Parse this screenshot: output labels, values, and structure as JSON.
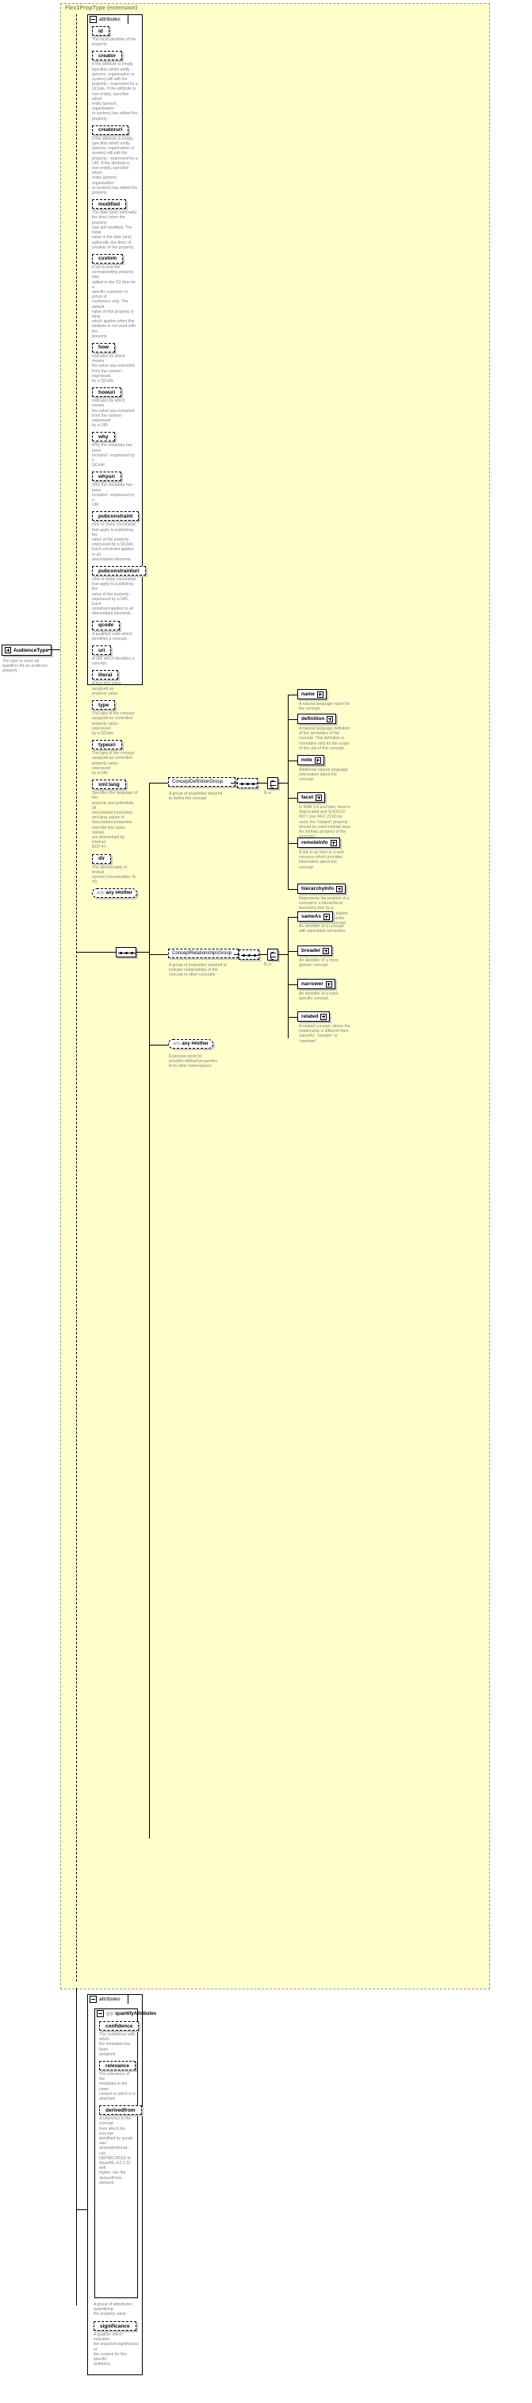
{
  "diagram": {
    "title": "Flex1PropType (extension)",
    "root_type": {
      "label": "AudienceType",
      "description": "The type to cover all\nqualifiers for an audience\nproperty."
    },
    "attributes_label": "attributes",
    "any_other": "any ##other",
    "any_other_2": "any ##other",
    "any_other_2_desc": "Extension point for\nprovider-defined properties\nfrom other namespaces.",
    "group_keyword": "grp"
  },
  "flex_attributes": [
    {
      "name": "id",
      "desc": "The local identifier of the\nproperty."
    },
    {
      "name": "creator",
      "desc": "If the attribute is empty,\nspecifies which entity\n(person, organisation or\nsystem) will edit the\nproperty - expressed by a\nQCode. If the attribute is\nnon-empty, specifies which\nentity (person, organisation\nor system) has edited the\nproperty."
    },
    {
      "name": "creatoruri",
      "desc": "If the attribute is empty,\nspecifies which entity\n(person, organisation or\nsystem) will edit the\nproperty - expressed by a\nURI. If the attribute is\nnon-empty, specifies which\nentity (person, organisation\nor system) has edited the\nproperty."
    },
    {
      "name": "modified",
      "desc": "The date (and, optionally,\nthe time) when the property\nwas last modified. The initial\nvalue is the date (and,\noptionally, the time) of\ncreation of the property."
    },
    {
      "name": "custom",
      "desc": "If set to true the\ncorresponding property was\nadded to the G2 Item for a\nspecific customer or group of\ncustomers only. The default\nvalue of this property is false\nwhich applies when this\nattribute is not used with the\nproperty."
    },
    {
      "name": "how",
      "desc": "Indicates by which means\nthe value was extracted\nfrom the content - expressed\nby a QCode"
    },
    {
      "name": "howuri",
      "desc": "Indicates by which means\nthe value was extracted\nfrom the content - expressed\nby a URI"
    },
    {
      "name": "why",
      "desc": "Why the metadata has been\nincluded - expressed by a\nQCode"
    },
    {
      "name": "whyuri",
      "desc": "Why the metadata has been\nincluded - expressed by a\nURI"
    },
    {
      "name": "pubconstraint",
      "desc": "One or many constraints\nthat apply to publishing the\nvalue of the property -\nexpressed by a QCode.\nEach constraint applies to all\ndescendant elements."
    },
    {
      "name": "pubconstrainturi",
      "desc": "One or many constraints\nthat apply to publishing the\nvalue of the property -\nexpressed by a URI. Each\nconstraint applies to all\ndescendant elements."
    },
    {
      "name": "qcode",
      "desc": "A qualified code which\nidentifies a concept."
    },
    {
      "name": "uri",
      "desc": "A URI which identifies a\nconcept."
    },
    {
      "name": "literal",
      "desc": "A free-text value assigned as\nproperty value."
    },
    {
      "name": "type",
      "desc": "The type of the concept\nassigned as controlled\nproperty value - expressed\nby a QCode"
    },
    {
      "name": "typeuri",
      "desc": "The type of the concept\nassigned as controlled\nproperty value - expressed\nby a URI"
    },
    {
      "name": "xml:lang",
      "desc": "Specifies the language of this\nproperty and potentially all\ndescendant properties;\nxml:lang values of\ndescendant properties\noverride this value. Values\nare determined by Internet\nBCP 47."
    },
    {
      "name": "dir",
      "desc": "The directionality of textual\ncontent (enumeration: ltr, rtl)"
    }
  ],
  "concept_definition_group": {
    "label": "ConceptDefinitionGroup",
    "desc": "A group of properties required\nto define the concept",
    "cardinality": "0..∞",
    "members": [
      {
        "name": "name",
        "desc": "A natural language name for\nthe concept."
      },
      {
        "name": "definition",
        "desc": "A natural language definition\nof the semantics of the\nconcept. This definition is\nnormative only for the scope\nof the use of this concept."
      },
      {
        "name": "note",
        "desc": "Additional natural language\ninformation about the\nconcept."
      },
      {
        "name": "facet",
        "desc": "In NAR 1.8 and later, facet is\ndeprecated and SHOULD\nNOT (see RFC 2119) be\nused, the \"related\" property\nshould be used instead (was:\nAn intrinsic property of the\nconcept.)"
      },
      {
        "name": "remoteInfo",
        "desc": "A link to an item or a web\nresource which provides\ninformation about the\nconcept"
      },
      {
        "name": "hierarchyInfo",
        "desc": "Represents the position of a\nconcept in a hierarchical\ntaxonomy tree by a\nsequence of QCode tokens\nrepresenting the ancestor\nconcepts and this concept"
      }
    ]
  },
  "concept_relationships_group": {
    "label": "ConceptRelationshipsGroup",
    "desc": "A group of properties required to\nindicate relationships of the\nconcept to other concepts",
    "cardinality": "0..∞",
    "members": [
      {
        "name": "sameAs",
        "desc": "An identifier of a concept\nwith equivalent semantics"
      },
      {
        "name": "broader",
        "desc": "An identifier of a more\ngeneric concept."
      },
      {
        "name": "narrower",
        "desc": "An identifier of a more\nspecific concept."
      },
      {
        "name": "related",
        "desc": "A related concept, where the\nrelationship is different from\n'sameAs', 'broader' or\n'narrower'."
      }
    ]
  },
  "quantify": {
    "attributes_label": "attributes",
    "group_label": "quantifyAttributes",
    "group_desc": "A group of attriubutes quantifying\nthe property value",
    "members": [
      {
        "name": "confidence",
        "desc": "The confidence with which\nthe metadata has been\nassigned."
      },
      {
        "name": "relevance",
        "desc": "The relevance of the\nmetadata to the news\ncontent to which it is\nattached."
      },
      {
        "name": "derivedfrom",
        "desc": "A reference to the concept\nfrom which the concept\nidentified by qcode was\nderived/inferred - use\nDEPRECATED in\nNewsML-G2 2.12 and\nhigher, use the derivedFrom\nelement"
      }
    ],
    "significance": {
      "name": "significance",
      "desc": "A qualifier which indicates\nthe expected significance of\nthe content for this specific\naudience."
    }
  }
}
